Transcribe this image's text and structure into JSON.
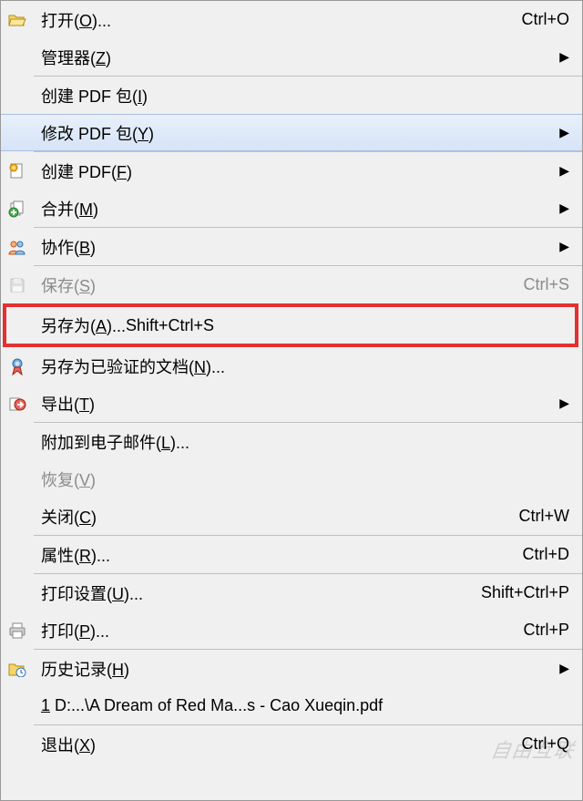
{
  "menu": {
    "open": {
      "label": "打开(",
      "mnemonic": "O",
      "suffix": ")...",
      "shortcut": "Ctrl+O"
    },
    "manager": {
      "label": "管理器(",
      "mnemonic": "Z",
      "suffix": ")"
    },
    "create_pkg": {
      "label": "创建 PDF 包(",
      "mnemonic": "I",
      "suffix": ")"
    },
    "modify_pkg": {
      "label": "修改 PDF 包(",
      "mnemonic": "Y",
      "suffix": ")"
    },
    "create_pdf": {
      "label": "创建 PDF(",
      "mnemonic": "F",
      "suffix": ")"
    },
    "merge": {
      "label": "合并(",
      "mnemonic": "M",
      "suffix": ")"
    },
    "collab": {
      "label": "协作(",
      "mnemonic": "B",
      "suffix": ")"
    },
    "save": {
      "label": "保存(",
      "mnemonic": "S",
      "suffix": ")",
      "shortcut": "Ctrl+S"
    },
    "save_as": {
      "label": "另存为(",
      "mnemonic": "A",
      "suffix": ")...",
      "shortcut": "Shift+Ctrl+S"
    },
    "save_verified": {
      "label": "另存为已验证的文档(",
      "mnemonic": "N",
      "suffix": ")..."
    },
    "export": {
      "label": "导出(",
      "mnemonic": "T",
      "suffix": ")"
    },
    "attach_email": {
      "label": "附加到电子邮件(",
      "mnemonic": "L",
      "suffix": ")..."
    },
    "restore": {
      "label": "恢复(",
      "mnemonic": "V",
      "suffix": ")"
    },
    "close": {
      "label": "关闭(",
      "mnemonic": "C",
      "suffix": ")",
      "shortcut": "Ctrl+W"
    },
    "properties": {
      "label": "属性(",
      "mnemonic": "R",
      "suffix": ")...",
      "shortcut": "Ctrl+D"
    },
    "print_setup": {
      "label": "打印设置(",
      "mnemonic": "U",
      "suffix": ")...",
      "shortcut": "Shift+Ctrl+P"
    },
    "print": {
      "label": "打印(",
      "mnemonic": "P",
      "suffix": ")...",
      "shortcut": "Ctrl+P"
    },
    "history": {
      "label": "历史记录(",
      "mnemonic": "H",
      "suffix": ")"
    },
    "recent": {
      "label": " D:...\\A Dream of Red Ma...s - Cao Xueqin.pdf",
      "mnemonic": "1"
    },
    "exit": {
      "label": "退出(",
      "mnemonic": "X",
      "suffix": ")",
      "shortcut": "Ctrl+Q"
    }
  },
  "watermark": "自由互联"
}
